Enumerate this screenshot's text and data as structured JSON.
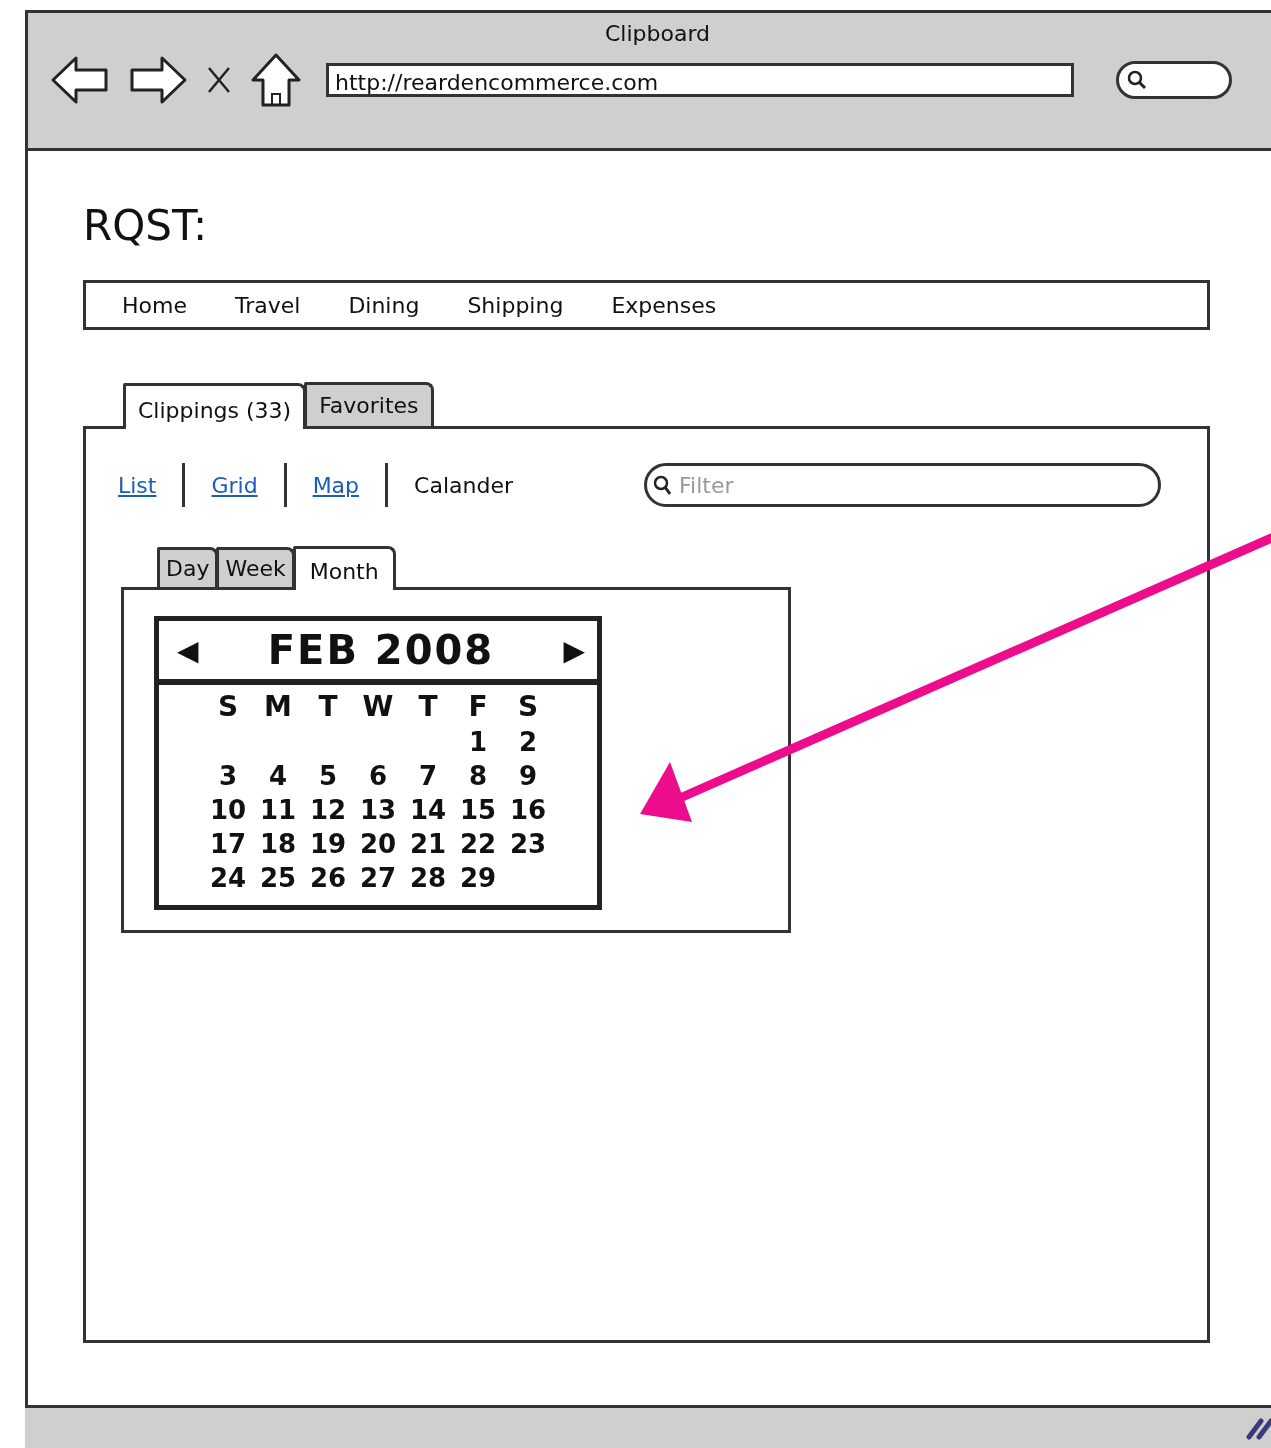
{
  "window": {
    "title": "Clipboard",
    "address": "http://reardencommerce.com"
  },
  "page": {
    "heading": "RQST:"
  },
  "nav": [
    "Home",
    "Travel",
    "Dining",
    "Shipping",
    "Expenses"
  ],
  "tabs": [
    {
      "label": "Clippings (33)",
      "selected": true
    },
    {
      "label": "Favorites",
      "selected": false
    }
  ],
  "views": [
    {
      "label": "List",
      "selected": false
    },
    {
      "label": "Grid",
      "selected": false
    },
    {
      "label": "Map",
      "selected": false
    },
    {
      "label": "Calander",
      "selected": true
    }
  ],
  "filter": {
    "placeholder": "Filter"
  },
  "calendar_tabs": [
    {
      "label": "Day",
      "selected": false
    },
    {
      "label": "Week",
      "selected": false
    },
    {
      "label": "Month",
      "selected": true
    }
  ],
  "calendar": {
    "month": "FEB 2008",
    "prev": "◀",
    "next": "▶",
    "weekdays": [
      "S",
      "M",
      "T",
      "W",
      "T",
      "F",
      "S"
    ],
    "weeks": [
      [
        "1",
        "2"
      ],
      [
        "3",
        "4",
        "5",
        "6",
        "7",
        "8",
        "9"
      ],
      [
        "10",
        "11",
        "12",
        "13",
        "14",
        "15",
        "16"
      ],
      [
        "17",
        "18",
        "19",
        "20",
        "21",
        "22",
        "23"
      ],
      [
        "24",
        "25",
        "26",
        "27",
        "28",
        "29"
      ]
    ]
  }
}
